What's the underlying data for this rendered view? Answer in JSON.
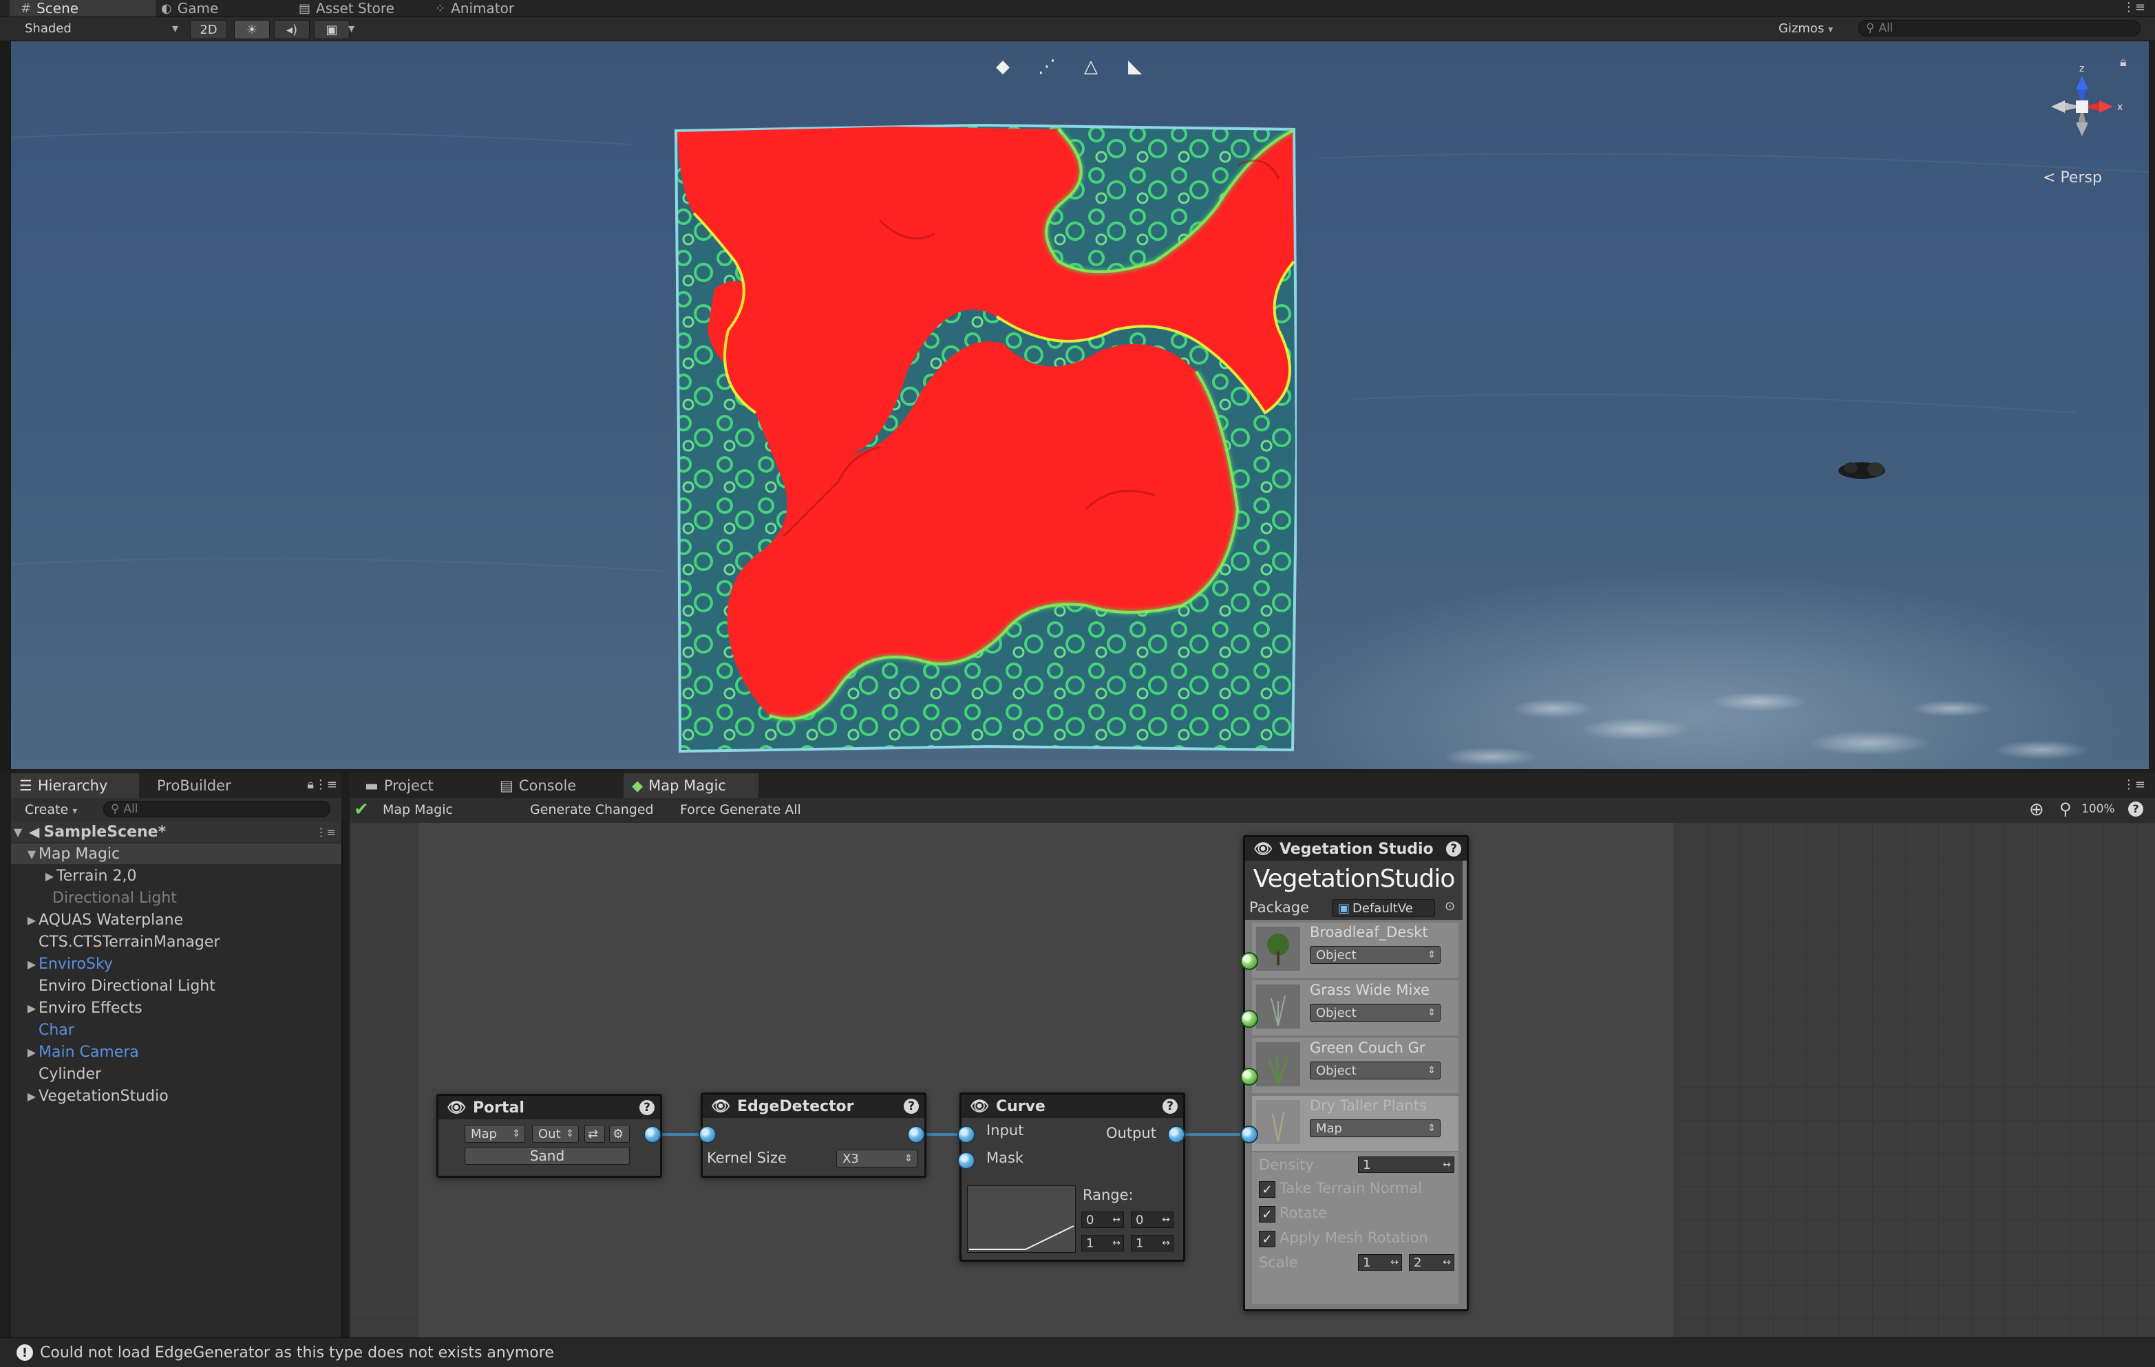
{
  "top_tabs": [
    {
      "label": "Scene",
      "icon": "grid-icon"
    },
    {
      "label": "Game",
      "icon": "pacman-icon"
    },
    {
      "label": "Asset Store",
      "icon": "bag-icon"
    },
    {
      "label": "Animator",
      "icon": "animator-icon"
    }
  ],
  "scene_toolbar": {
    "shading_mode": "Shaded",
    "toggle_2d": "2D",
    "gizmos_label": "Gizmos",
    "search_placeholder": "All"
  },
  "scene_view": {
    "projection_label": "Persp",
    "gizmo_axes": {
      "x": "x",
      "z": "z"
    },
    "colors": {
      "terrain_fill": "#ff2020",
      "shore_green": "#4ad27a",
      "highlight_yellow": "#e8ff3a",
      "ocean": "#3f5b7d"
    }
  },
  "hierarchy": {
    "tabs": [
      "Hierarchy",
      "ProBuilder"
    ],
    "create_label": "Create",
    "search_placeholder": "All",
    "scene_name": "SampleScene*",
    "items": [
      {
        "label": "Map Magic",
        "style": "normal"
      },
      {
        "label": "Terrain 2,0",
        "style": "normal"
      },
      {
        "label": "Directional Light",
        "style": "dim"
      },
      {
        "label": "AQUAS Waterplane",
        "style": "normal"
      },
      {
        "label": "CTS.CTSTerrainManager",
        "style": "normal"
      },
      {
        "label": "EnviroSky",
        "style": "blue"
      },
      {
        "label": "Enviro Directional Light",
        "style": "normal"
      },
      {
        "label": "Enviro Effects",
        "style": "normal"
      },
      {
        "label": "Char",
        "style": "blue"
      },
      {
        "label": "Main Camera",
        "style": "blue"
      },
      {
        "label": "Cylinder",
        "style": "normal"
      },
      {
        "label": "VegetationStudio",
        "style": "normal"
      }
    ]
  },
  "map_magic": {
    "tabs": [
      "Project",
      "Console",
      "Map Magic"
    ],
    "toolbar": {
      "title": "Map Magic",
      "generate_changed": "Generate Changed",
      "force_generate_all": "Force Generate All",
      "zoom": "100%"
    },
    "nodes": {
      "portal": {
        "title": "Portal",
        "type_dd": "Map",
        "io_dd": "Out",
        "name_btn": "Sand"
      },
      "edge_detector": {
        "title": "EdgeDetector",
        "kernel_label": "Kernel Size",
        "kernel_value": "X3"
      },
      "curve": {
        "title": "Curve",
        "input": "Input",
        "mask": "Mask",
        "output": "Output",
        "range_label": "Range:",
        "range_min_x": "0",
        "range_min_y": "0",
        "range_max_x": "1",
        "range_max_y": "1"
      },
      "vegetation_studio": {
        "title": "Vegetation Studio",
        "logo_text": "VegetationStudio",
        "package_label": "Package",
        "package_value": "DefaultVe",
        "items": [
          {
            "name": "Broadleaf_Deskt",
            "mode": "Object"
          },
          {
            "name": "Grass Wide Mixe",
            "mode": "Object"
          },
          {
            "name": "Green Couch Gr",
            "mode": "Object"
          },
          {
            "name": "Dry Taller Plants",
            "mode": "Map"
          }
        ],
        "density_label": "Density",
        "density_value": "1",
        "take_terrain_normal": "Take Terrain Normal",
        "rotate": "Rotate",
        "apply_mesh_rotation": "Apply Mesh Rotation",
        "scale_label": "Scale",
        "scale_min": "1",
        "scale_max": "2"
      }
    }
  },
  "status_bar": {
    "message": "Could not load EdgeGenerator as this type does not exists anymore"
  }
}
